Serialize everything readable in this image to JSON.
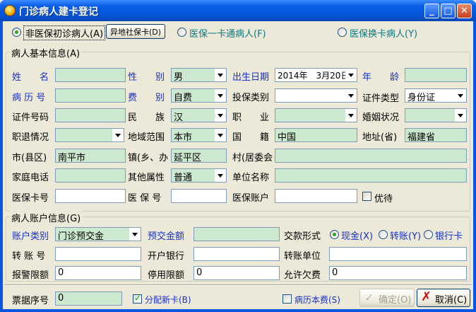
{
  "window": {
    "title": "门诊病人建卡登记",
    "minimize": "_",
    "maximize": "□",
    "close": "✕"
  },
  "card_type": {
    "options": [
      {
        "label": "非医保初诊病人(A)",
        "selected": true
      },
      {
        "label": "异地社保卡(D)",
        "selected": false
      },
      {
        "label": "医保一卡通病人(F)",
        "selected": false
      },
      {
        "label": "医保换卡病人(Y)",
        "selected": false
      }
    ]
  },
  "basic_info": {
    "title": "病人基本信息(A)",
    "name_label": "姓　　名",
    "name": "",
    "gender_label": "性　　别",
    "gender": "男",
    "birth_label": "出生日期",
    "birth": "2014年　3月20日",
    "age_label": "年　　龄",
    "age": "",
    "record_no_label": "病 历 号",
    "record_no": "",
    "fee_label": "费　　别",
    "fee": "自费",
    "insure_type_label": "投保类别",
    "insure_type": "",
    "id_type_label": "证件类型",
    "id_type": "身份证",
    "id_no_label": "证件号码",
    "id_no": "",
    "nation_label": "民　　族",
    "nation": "汉",
    "job_label": "职　　业",
    "job": "",
    "marriage_label": "婚姻状况",
    "marriage": "",
    "retire_label": "职退情况",
    "retire": "",
    "region_label": "地域范围",
    "region": "本市",
    "country_label": "国　　籍",
    "country": "中国",
    "province_label": "地址(省)",
    "province": "福建省",
    "city_label": "市(县区)",
    "city": "南平市",
    "town_label": "镇(乡、办",
    "town": "延平区",
    "village_label": "村(居委会",
    "village": "",
    "home_phone_label": "家庭电话",
    "home_phone": "",
    "other_attr_label": "其他属性",
    "other_attr": "普通",
    "company_label": "单位名称",
    "company": "",
    "ins_card_label": "医保卡号",
    "ins_card": "",
    "ins_no_label": "医 保 号",
    "ins_no": "",
    "ins_account_label": "医保账户",
    "ins_account": "",
    "priority_label": "优待"
  },
  "account_info": {
    "title": "病人账户信息(G)",
    "account_type_label": "账户类别",
    "account_type": "门诊预交金",
    "prepay_label": "预交金额",
    "prepay": "",
    "payment_label": "交款形式",
    "payment_options": [
      {
        "label": "现金(X)",
        "selected": true
      },
      {
        "label": "转账(Y)",
        "selected": false
      },
      {
        "label": "银行卡",
        "selected": false
      }
    ],
    "transfer_no_label": "转 账 号",
    "transfer_no": "",
    "bank_label": "开户银行",
    "bank": "",
    "transfer_unit_label": "转账单位",
    "transfer_unit": "",
    "alarm_label": "报警限额",
    "alarm": "0",
    "stop_label": "停用限额",
    "stop": "0",
    "arrears_label": "允许欠费",
    "arrears": "0"
  },
  "footer": {
    "receipt_label": "票据序号",
    "receipt": "0",
    "assign_card_label": "分配新卡(B)",
    "assign_card": true,
    "record_fee_label": "病历本费(S)",
    "record_fee": false,
    "ok_label": "确定(O)",
    "cancel_label": "取消(C)"
  }
}
